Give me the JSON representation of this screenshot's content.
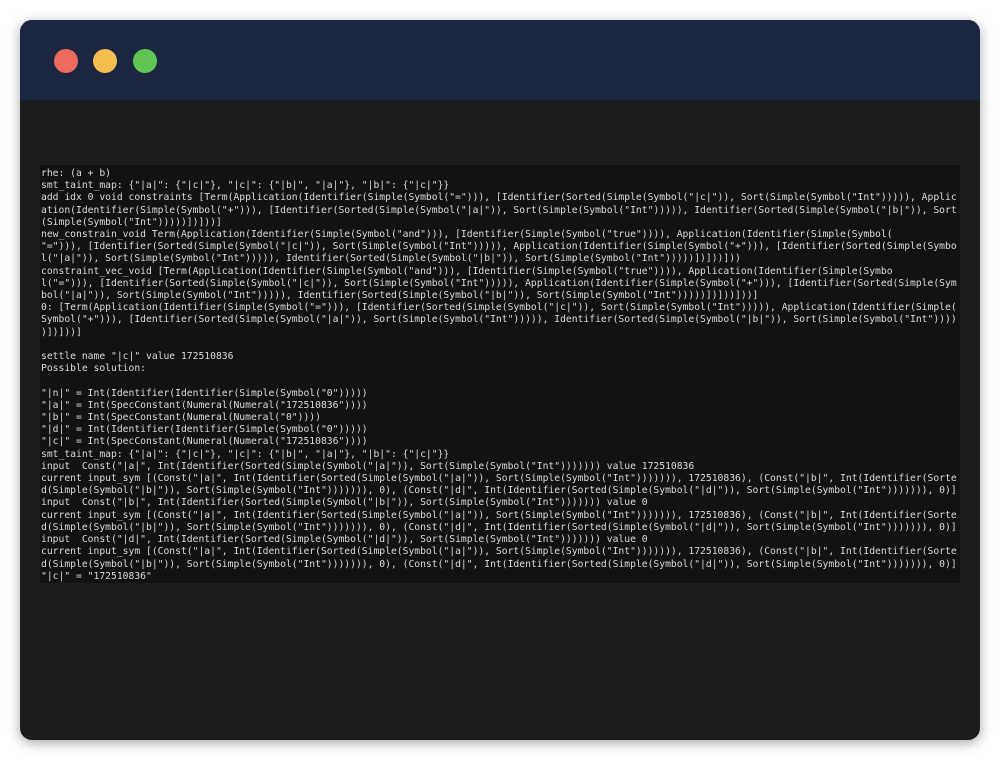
{
  "window": {
    "buttons": {
      "close_color": "#ed6a5e",
      "minimize_color": "#f5bf4f",
      "maximize_color": "#61c554"
    }
  },
  "terminal": {
    "lines": [
      "rhe: (a + b)",
      "smt_taint_map: {\"|a|\": {\"|c|\"}, \"|c|\": {\"|b|\", \"|a|\"}, \"|b|\": {\"|c|\"}}",
      "add idx 0 void constraints [Term(Application(Identifier(Simple(Symbol(\"=\"))), [Identifier(Sorted(Simple(Symbol(\"|c|\")), Sort(Simple(Symbol(\"Int\"))))), Applic",
      "ation(Identifier(Simple(Symbol(\"+\"))), [Identifier(Sorted(Simple(Symbol(\"|a|\")), Sort(Simple(Symbol(\"Int\"))))), Identifier(Sorted(Simple(Symbol(\"|b|\")), Sort",
      "(Simple(Symbol(\"Int\")))))])]))]",
      "new_constrain_void Term(Application(Identifier(Simple(Symbol(\"and\"))), [Identifier(Simple(Symbol(\"true\")))), Application(Identifier(Simple(Symbol(",
      "\"=\"))), [Identifier(Sorted(Simple(Symbol(\"|c|\")), Sort(Simple(Symbol(\"Int\"))))), Application(Identifier(Simple(Symbol(\"+\"))), [Identifier(Sorted(Simple(Symbo",
      "l(\"|a|\")), Sort(Simple(Symbol(\"Int\"))))), Identifier(Sorted(Simple(Symbol(\"|b|\")), Sort(Simple(Symbol(\"Int\")))))])]))]))",
      "constraint_vec_void [Term(Application(Identifier(Simple(Symbol(\"and\"))), [Identifier(Simple(Symbol(\"true\")))), Application(Identifier(Simple(Symbo",
      "l(\"=\"))), [Identifier(Sorted(Simple(Symbol(\"|c|\")), Sort(Simple(Symbol(\"Int\"))))), Application(Identifier(Simple(Symbol(\"+\"))), [Identifier(Sorted(Simple(Sym",
      "bol(\"|a|\")), Sort(Simple(Symbol(\"Int\"))))), Identifier(Sorted(Simple(Symbol(\"|b|\")), Sort(Simple(Symbol(\"Int\")))))])]))]))]",
      "0: [Term(Application(Identifier(Simple(Symbol(\"=\"))), [Identifier(Sorted(Simple(Symbol(\"|c|\")), Sort(Simple(Symbol(\"Int\"))))), Application(Identifier(Simple(",
      "Symbol(\"+\"))), [Identifier(Sorted(Simple(Symbol(\"|a|\")), Sort(Simple(Symbol(\"Int\"))))), Identifier(Sorted(Simple(Symbol(\"|b|\")), Sort(Simple(Symbol(\"Int\"))))",
      ")])]))]",
      "",
      "settle name \"|c|\" value 172510836",
      "Possible solution:",
      "",
      "\"|n|\" = Int(Identifier(Identifier(Simple(Symbol(\"0\")))))",
      "\"|a|\" = Int(SpecConstant(Numeral(Numeral(\"172510836\"))))",
      "\"|b|\" = Int(SpecConstant(Numeral(Numeral(\"0\"))))",
      "\"|d|\" = Int(Identifier(Identifier(Simple(Symbol(\"0\")))))",
      "\"|c|\" = Int(SpecConstant(Numeral(Numeral(\"172510836\"))))",
      "smt_taint_map: {\"|a|\": {\"|c|\"}, \"|c|\": {\"|b|\", \"|a|\"}, \"|b|\": {\"|c|\"}}",
      "input  Const(\"|a|\", Int(Identifier(Sorted(Simple(Symbol(\"|a|\")), Sort(Simple(Symbol(\"Int\"))))))) value 172510836",
      "current input_sym [(Const(\"|a|\", Int(Identifier(Sorted(Simple(Symbol(\"|a|\")), Sort(Simple(Symbol(\"Int\"))))))), 172510836), (Const(\"|b|\", Int(Identifier(Sorte",
      "d(Simple(Symbol(\"|b|\")), Sort(Simple(Symbol(\"Int\"))))))), 0), (Const(\"|d|\", Int(Identifier(Sorted(Simple(Symbol(\"|d|\")), Sort(Simple(Symbol(\"Int\"))))))), 0)]",
      "input  Const(\"|b|\", Int(Identifier(Sorted(Simple(Symbol(\"|b|\")), Sort(Simple(Symbol(\"Int\"))))))) value 0",
      "current input_sym [(Const(\"|a|\", Int(Identifier(Sorted(Simple(Symbol(\"|a|\")), Sort(Simple(Symbol(\"Int\"))))))), 172510836), (Const(\"|b|\", Int(Identifier(Sorte",
      "d(Simple(Symbol(\"|b|\")), Sort(Simple(Symbol(\"Int\"))))))), 0), (Const(\"|d|\", Int(Identifier(Sorted(Simple(Symbol(\"|d|\")), Sort(Simple(Symbol(\"Int\"))))))), 0)]",
      "input  Const(\"|d|\", Int(Identifier(Sorted(Simple(Symbol(\"|d|\")), Sort(Simple(Symbol(\"Int\"))))))) value 0",
      "current input_sym [(Const(\"|a|\", Int(Identifier(Sorted(Simple(Symbol(\"|a|\")), Sort(Simple(Symbol(\"Int\"))))))), 172510836), (Const(\"|b|\", Int(Identifier(Sorte",
      "d(Simple(Symbol(\"|b|\")), Sort(Simple(Symbol(\"Int\"))))))), 0), (Const(\"|d|\", Int(Identifier(Sorted(Simple(Symbol(\"|d|\")), Sort(Simple(Symbol(\"Int\"))))))), 0)]",
      "\"|c|\" = \"172510836\""
    ]
  }
}
